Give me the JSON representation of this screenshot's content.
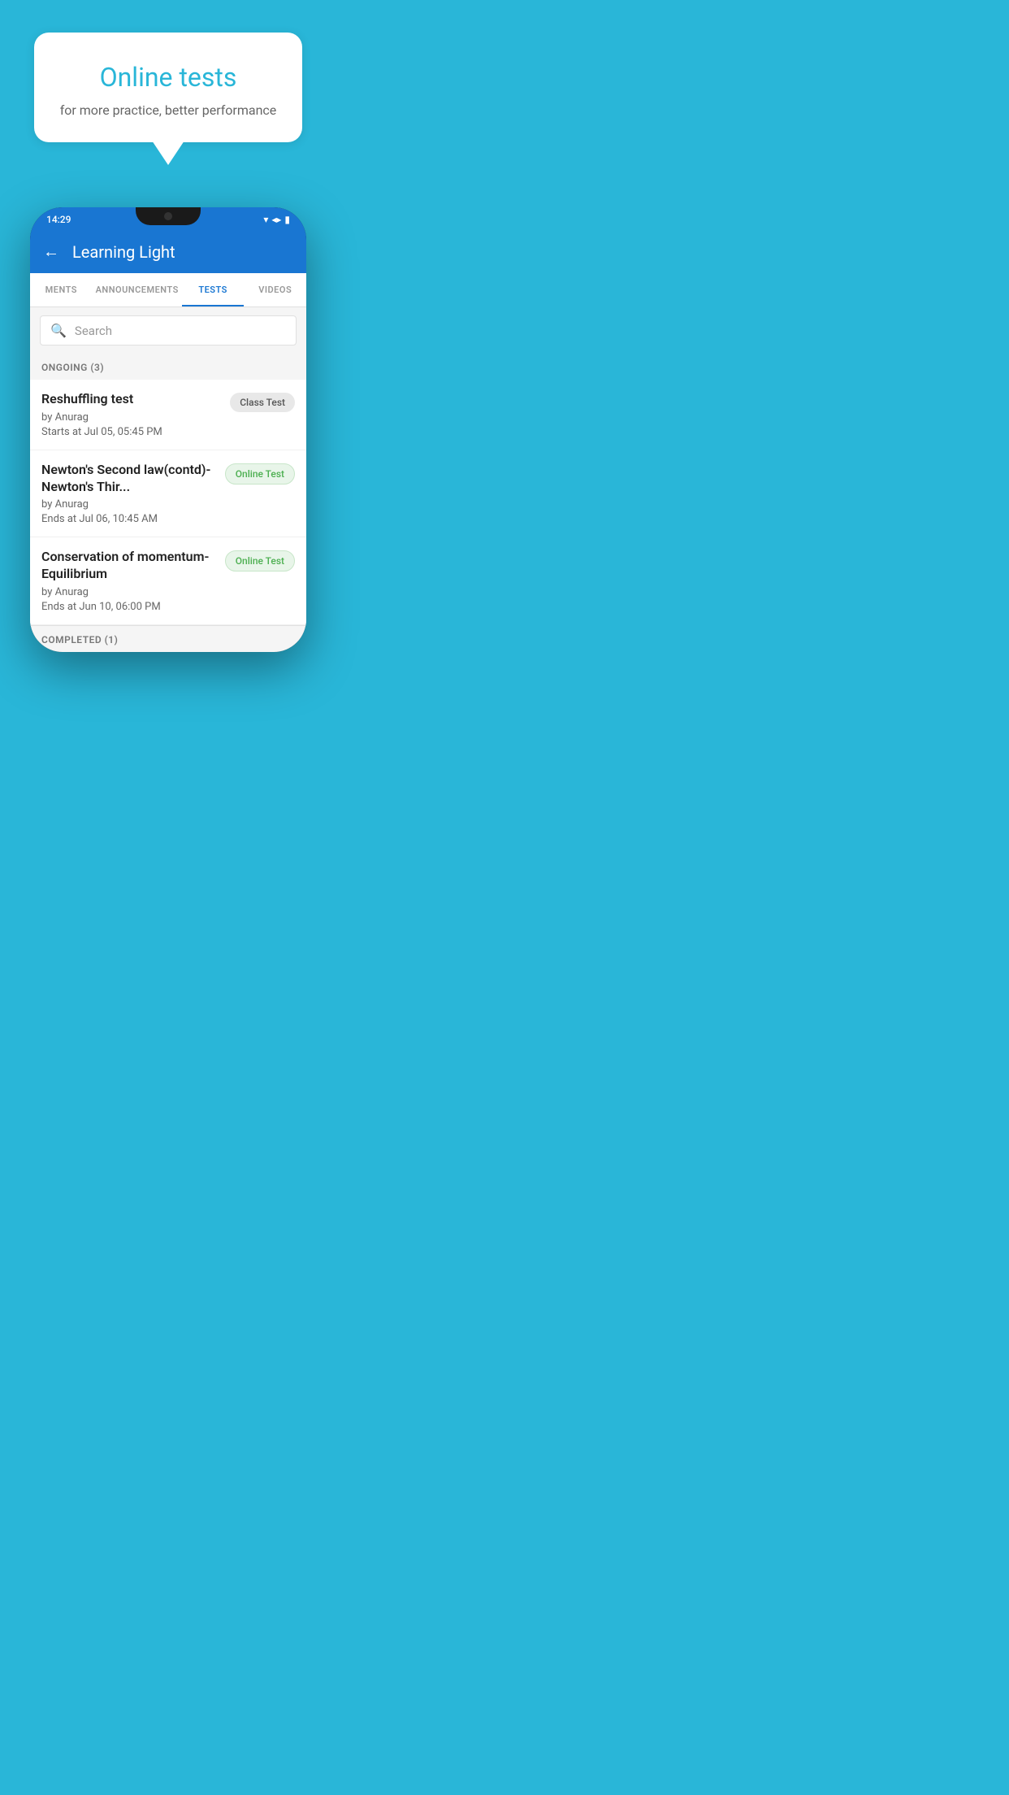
{
  "background_color": "#29b6d8",
  "hero": {
    "title": "Online tests",
    "subtitle": "for more practice, better performance"
  },
  "phone": {
    "status_bar": {
      "time": "14:29",
      "icons": [
        "wifi",
        "signal",
        "battery"
      ]
    },
    "app_bar": {
      "back_label": "←",
      "title": "Learning Light"
    },
    "tabs": [
      {
        "label": "MENTS",
        "active": false
      },
      {
        "label": "ANNOUNCEMENTS",
        "active": false
      },
      {
        "label": "TESTS",
        "active": true
      },
      {
        "label": "VIDEOS",
        "active": false
      }
    ],
    "search": {
      "placeholder": "Search"
    },
    "ongoing_section": {
      "header": "ONGOING (3)",
      "tests": [
        {
          "title": "Reshuffling test",
          "author": "by Anurag",
          "date": "Starts at  Jul 05, 05:45 PM",
          "badge": "Class Test",
          "badge_type": "class"
        },
        {
          "title": "Newton's Second law(contd)-Newton's Thir...",
          "author": "by Anurag",
          "date": "Ends at  Jul 06, 10:45 AM",
          "badge": "Online Test",
          "badge_type": "online"
        },
        {
          "title": "Conservation of momentum-Equilibrium",
          "author": "by Anurag",
          "date": "Ends at  Jun 10, 06:00 PM",
          "badge": "Online Test",
          "badge_type": "online"
        }
      ]
    },
    "completed_section": {
      "header": "COMPLETED (1)"
    }
  }
}
